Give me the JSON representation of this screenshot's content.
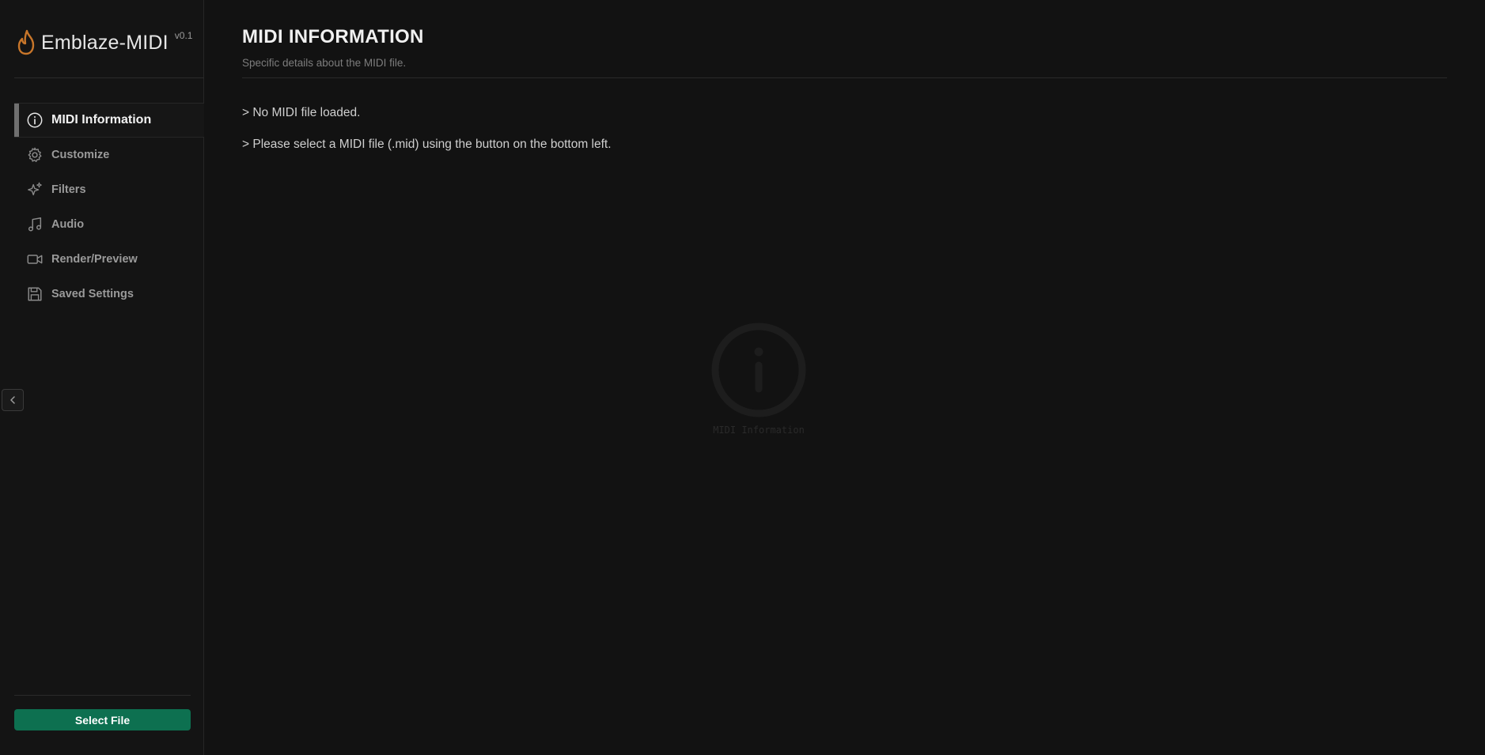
{
  "brand": {
    "name": "Emblaze-MIDI",
    "version": "v0.1",
    "accent": "#c8762a"
  },
  "sidebar": {
    "items": [
      {
        "label": "MIDI Information",
        "icon": "info-icon",
        "active": true
      },
      {
        "label": "Customize",
        "icon": "gear-icon",
        "active": false
      },
      {
        "label": "Filters",
        "icon": "sparkles-icon",
        "active": false
      },
      {
        "label": "Audio",
        "icon": "music-note-icon",
        "active": false
      },
      {
        "label": "Render/Preview",
        "icon": "video-camera-icon",
        "active": false
      },
      {
        "label": "Saved Settings",
        "icon": "save-icon",
        "active": false
      }
    ],
    "collapse_icon": "chevron-left-icon",
    "select_file_label": "Select File",
    "select_file_color": "#0d7050"
  },
  "main": {
    "title": "MIDI INFORMATION",
    "subtitle": "Specific details about the MIDI file.",
    "messages": [
      "> No MIDI file loaded.",
      "> Please select a MIDI file (.mid) using the button on the bottom left."
    ],
    "watermark_label": "MIDI Information",
    "watermark_icon": "info-icon"
  }
}
